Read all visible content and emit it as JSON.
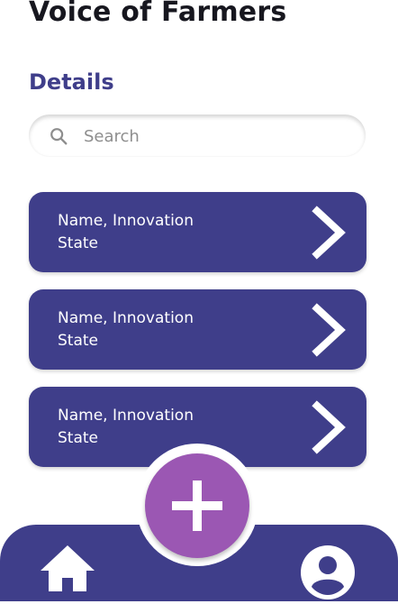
{
  "header": {
    "title": "Voice of Farmers"
  },
  "section": {
    "title": "Details"
  },
  "search": {
    "placeholder": "Search",
    "icon": "search-icon"
  },
  "cards": [
    {
      "line1": "Name, Innovation",
      "line2": "State",
      "icon": "chevron-right-icon"
    },
    {
      "line1": "Name, Innovation",
      "line2": "State",
      "icon": "chevron-right-icon"
    },
    {
      "line1": "Name, Innovation",
      "line2": "State",
      "icon": "chevron-right-icon"
    }
  ],
  "fab": {
    "icon": "plus-icon"
  },
  "bottom_nav": {
    "left_icon": "home-icon",
    "right_icon": "profile-icon"
  },
  "colors": {
    "primary": "#3f3e8a",
    "accent": "#9b57b3",
    "text": "#17171f",
    "background": "#ffffff"
  }
}
